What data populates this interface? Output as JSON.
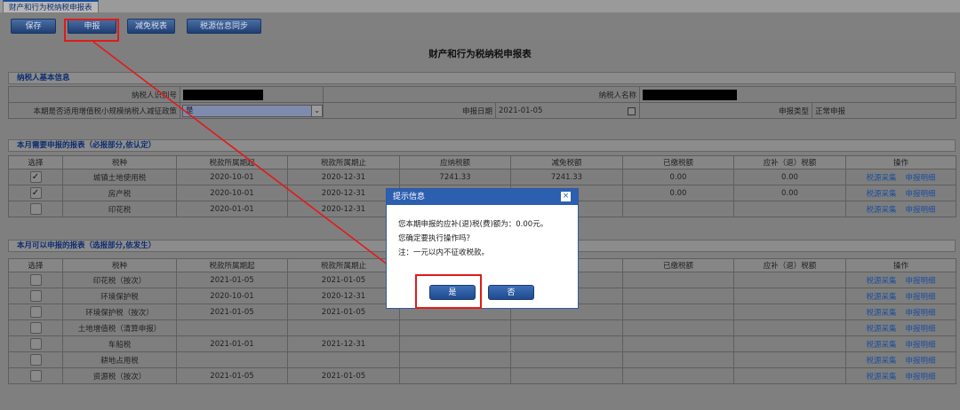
{
  "window": {
    "tab_title": "财产和行为税纳税申报表"
  },
  "toolbar": {
    "save": "保存",
    "declare": "申报",
    "reduce": "减免税表",
    "sync": "税源信息同步"
  },
  "page_title": "财产和行为税纳税申报表",
  "basic_info": {
    "section_title": "纳税人基本信息",
    "taxpayer_id_label": "纳税人识别号",
    "taxpayer_name_label": "纳税人名称",
    "policy_label": "本期是否适用增值税小规模纳税人减征政策",
    "policy_value": "是",
    "declare_date_label": "申报日期",
    "declare_date_value": "2021-01-05",
    "declare_type_label": "申报类型",
    "declare_type_value": "正常申报"
  },
  "required_section": {
    "title": "本月需要申报的报表（必报部分,依认定）",
    "headers": [
      "选择",
      "税种",
      "税款所属期起",
      "税款所属期止",
      "应纳税额",
      "减免税额",
      "已缴税额",
      "应补（退）税额",
      "操作"
    ],
    "rows": [
      {
        "checked": "✓",
        "tax": "城镇土地使用税",
        "start": "2020-10-01",
        "end": "2020-12-31",
        "payable": "7241.33",
        "reduction": "7241.33",
        "paid": "0.00",
        "due": "0.00"
      },
      {
        "checked": "✓",
        "tax": "房产税",
        "start": "2020-10-01",
        "end": "2020-12-31",
        "payable": "",
        "reduction": "",
        "paid": "0.00",
        "due": "0.00"
      },
      {
        "checked": "",
        "tax": "印花税",
        "start": "2020-01-01",
        "end": "2020-12-31",
        "payable": "",
        "reduction": "",
        "paid": "",
        "due": ""
      }
    ]
  },
  "optional_section": {
    "title": "本月可以申报的报表（选报部分,依发生）",
    "headers": [
      "选择",
      "税种",
      "税款所属期起",
      "税款所属期止",
      "",
      "",
      "已缴税额",
      "应补（退）税额",
      "操作"
    ],
    "rows": [
      {
        "tax": "印花税（按次）",
        "start": "2021-01-05",
        "end": "2021-01-05"
      },
      {
        "tax": "环境保护税",
        "start": "2020-10-01",
        "end": "2020-12-31"
      },
      {
        "tax": "环境保护税（按次）",
        "start": "2021-01-05",
        "end": "2021-01-05"
      },
      {
        "tax": "土地增值税（清算申报）",
        "start": "",
        "end": ""
      },
      {
        "tax": "车船税",
        "start": "2021-01-01",
        "end": "2021-12-31"
      },
      {
        "tax": "耕地占用税",
        "start": "",
        "end": ""
      },
      {
        "tax": "资源税（按次）",
        "start": "2021-01-05",
        "end": "2021-01-05"
      }
    ]
  },
  "actions": {
    "collect": "税源采集",
    "detail": "申报明细"
  },
  "dialog": {
    "title": "提示信息",
    "close": "×",
    "line1": "您本期申报的应补(退)税(费)额为：0.00元。",
    "line2": "您确定要执行操作吗？",
    "line3": "注：一元以内不征收税款。",
    "yes": "是",
    "no": "否"
  },
  "annotations": {
    "color": "#e21a1a"
  }
}
